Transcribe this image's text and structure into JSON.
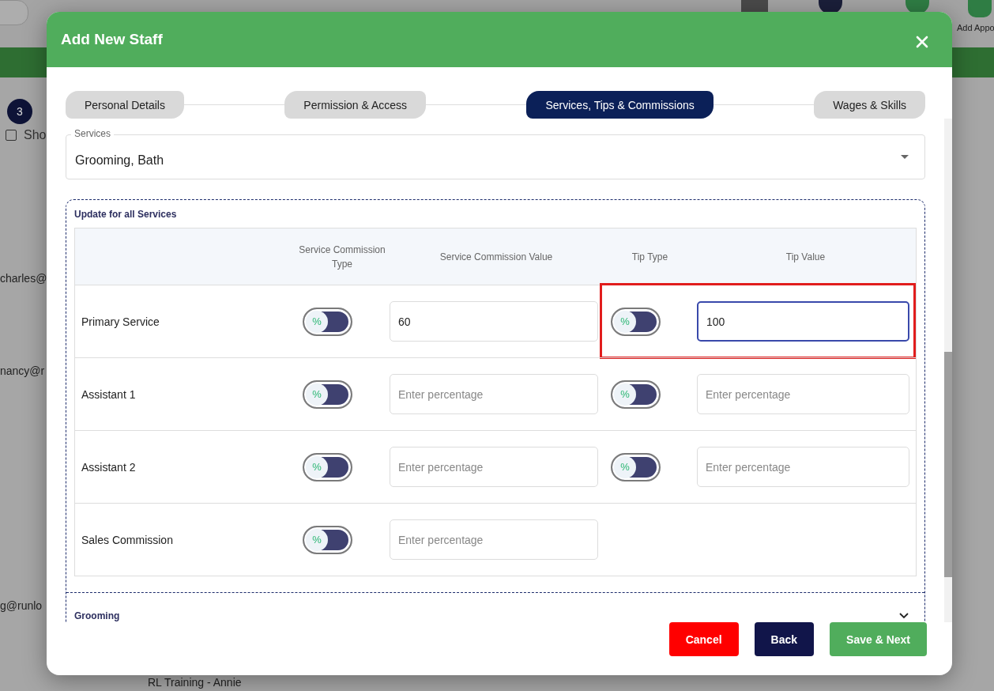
{
  "background": {
    "badge": "3",
    "checkbox": {
      "label": "Sho",
      "checked": false
    },
    "emails": [
      "charles@",
      "nancy@r",
      "g@runlo"
    ],
    "footer_text": "RL Training - Annie",
    "toolbar_label": "Add Appo"
  },
  "modal": {
    "title": "Add New Staff",
    "tabs": [
      {
        "label": "Personal Details",
        "selected": false
      },
      {
        "label": "Permission & Access",
        "selected": false
      },
      {
        "label": "Services, Tips & Commissions",
        "selected": true
      },
      {
        "label": "Wages & Skills",
        "selected": false
      }
    ],
    "services_field": {
      "label": "Services",
      "value": "Grooming, Bath"
    },
    "section": {
      "title": "Update for all Services",
      "columns": [
        "Service Commission Type",
        "Service Commission Value",
        "Tip Type",
        "Tip Value"
      ],
      "rows": [
        {
          "label": "Primary Service",
          "highlighted": true,
          "commission_toggle": {
            "symbol": "%",
            "on": false
          },
          "commission_value": {
            "value": "60",
            "focused": false
          },
          "tip_toggle": {
            "symbol": "%",
            "on": false
          },
          "tip_value": {
            "value": "100",
            "focused": true
          }
        },
        {
          "label": "Assistant 1",
          "highlighted": false,
          "commission_toggle": {
            "symbol": "%",
            "on": false
          },
          "commission_value": {
            "placeholder": "Enter percentage",
            "focused": false
          },
          "tip_toggle": {
            "symbol": "%",
            "on": false
          },
          "tip_value": {
            "placeholder": "Enter percentage",
            "focused": false
          }
        },
        {
          "label": "Assistant 2",
          "highlighted": false,
          "commission_toggle": {
            "symbol": "%",
            "on": false
          },
          "commission_value": {
            "placeholder": "Enter percentage",
            "focused": false
          },
          "tip_toggle": {
            "symbol": "%",
            "on": false
          },
          "tip_value": {
            "placeholder": "Enter percentage",
            "focused": false
          }
        },
        {
          "label": "Sales Commission",
          "highlighted": false,
          "commission_toggle": {
            "symbol": "%",
            "on": false
          },
          "commission_value": {
            "placeholder": "Enter percentage",
            "focused": false
          }
        }
      ]
    },
    "collapsed_section": {
      "title": "Grooming",
      "expanded": false
    },
    "buttons": [
      {
        "label": "Cancel",
        "kind": "cancel"
      },
      {
        "label": "Back",
        "kind": "back"
      },
      {
        "label": "Save & Next",
        "kind": "primary"
      }
    ]
  }
}
